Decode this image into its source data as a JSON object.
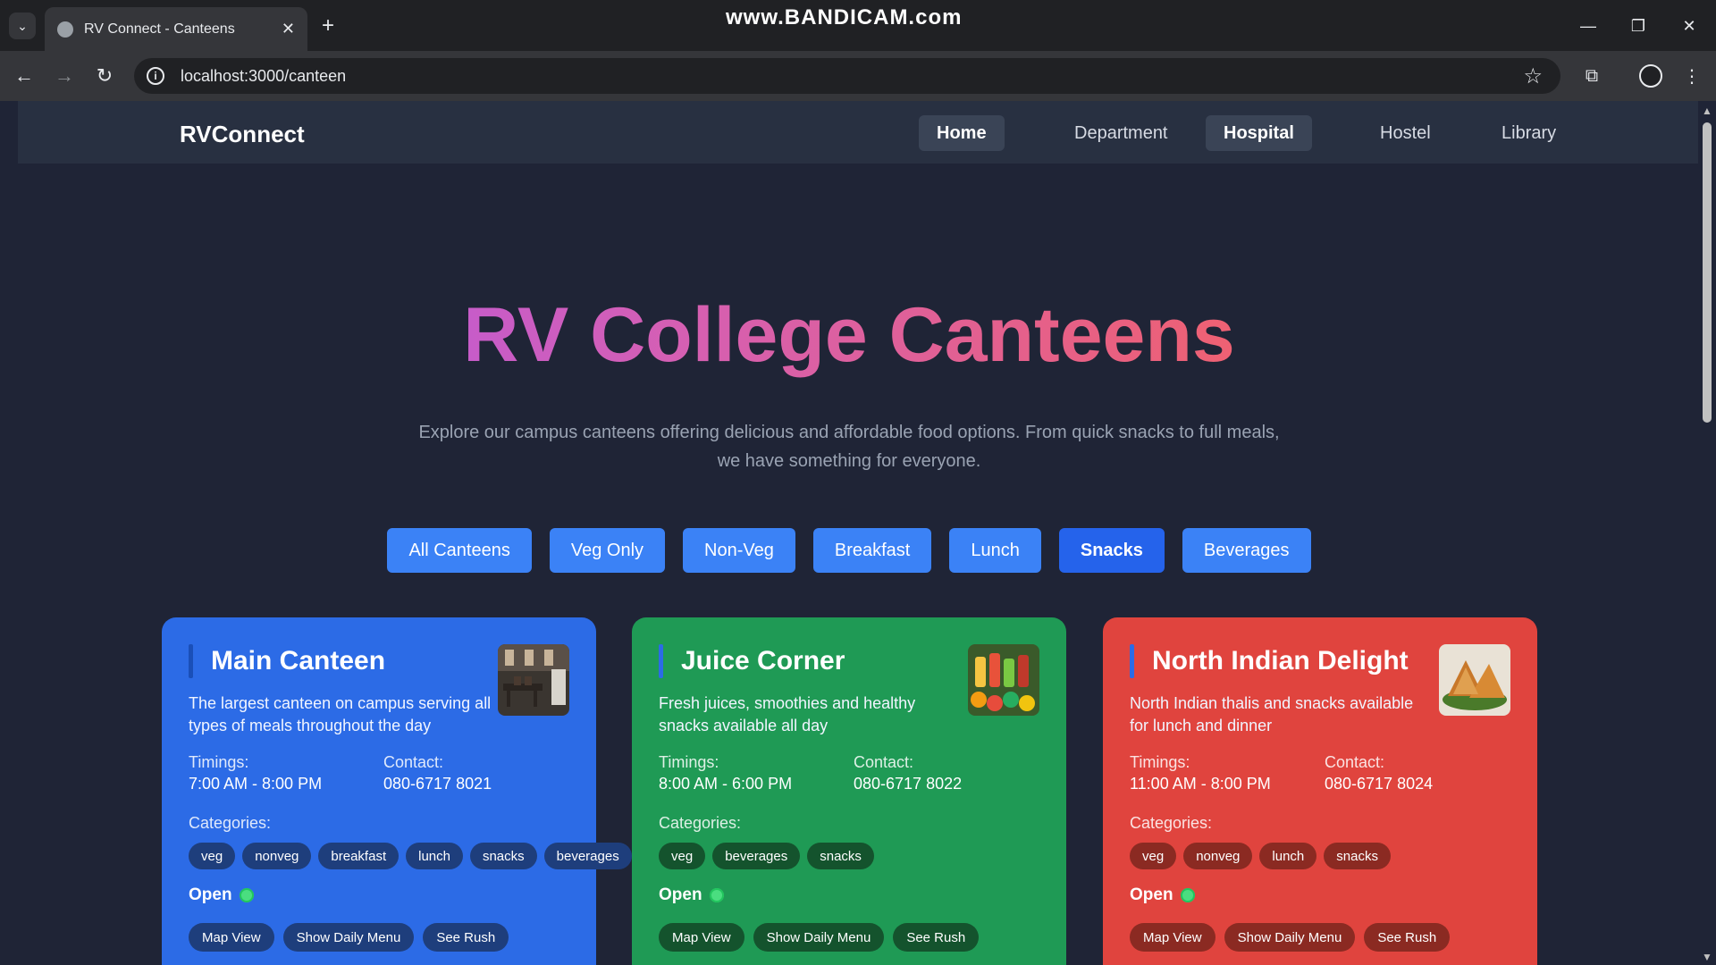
{
  "browser": {
    "tab_title": "RV Connect - Canteens",
    "url": "localhost:3000/canteen",
    "watermark": "www.BANDICAM.com",
    "icons": [
      "tab-list-icon",
      "close-icon",
      "plus-icon",
      "minimize-icon",
      "restore-icon",
      "close-window-icon",
      "back-icon",
      "forward-icon",
      "reload-icon",
      "info-icon",
      "star-icon",
      "extensions-icon",
      "profile-icon",
      "menu-icon"
    ]
  },
  "site": {
    "brand": "RVConnect",
    "nav": [
      {
        "label": "Home",
        "active": true
      },
      {
        "label": "Department",
        "active": false
      },
      {
        "label": "Hospital",
        "active": true
      },
      {
        "label": "Hostel",
        "active": false
      },
      {
        "label": "Library",
        "active": false
      }
    ]
  },
  "hero": {
    "title": "RV College Canteens",
    "subtitle": "Explore our campus canteens offering delicious and affordable food options. From quick snacks to full meals, we have something for everyone."
  },
  "filters": [
    "All Canteens",
    "Veg Only",
    "Non-Veg",
    "Breakfast",
    "Lunch",
    "Snacks",
    "Beverages"
  ],
  "labels": {
    "timings": "Timings:",
    "contact": "Contact:",
    "categories": "Categories:",
    "open": "Open"
  },
  "cards": [
    {
      "name": "Main Canteen",
      "description": "The largest canteen on campus serving all types of meals throughout the day",
      "timings": "7:00 AM - 8:00 PM",
      "contact": "080-6717 8021",
      "categories": [
        "veg",
        "nonveg",
        "breakfast",
        "lunch",
        "snacks",
        "beverages"
      ],
      "status": "Open",
      "color": "#2c6be6",
      "actions": [
        "Map View",
        "Show Daily Menu",
        "See Rush"
      ]
    },
    {
      "name": "Juice Corner",
      "description": "Fresh juices, smoothies and healthy snacks available all day",
      "timings": "8:00 AM - 6:00 PM",
      "contact": "080-6717 8022",
      "categories": [
        "veg",
        "beverages",
        "snacks"
      ],
      "status": "Open",
      "color": "#1f9a55",
      "actions": [
        "Map View",
        "Show Daily Menu",
        "See Rush"
      ]
    },
    {
      "name": "North Indian Delight",
      "description": "North Indian thalis and snacks available for lunch and dinner",
      "timings": "11:00 AM - 8:00 PM",
      "contact": "080-6717 8024",
      "categories": [
        "veg",
        "nonveg",
        "lunch",
        "snacks"
      ],
      "status": "Open",
      "color": "#e0443e",
      "actions": [
        "Map View",
        "Show Daily Menu",
        "See Rush"
      ]
    }
  ]
}
